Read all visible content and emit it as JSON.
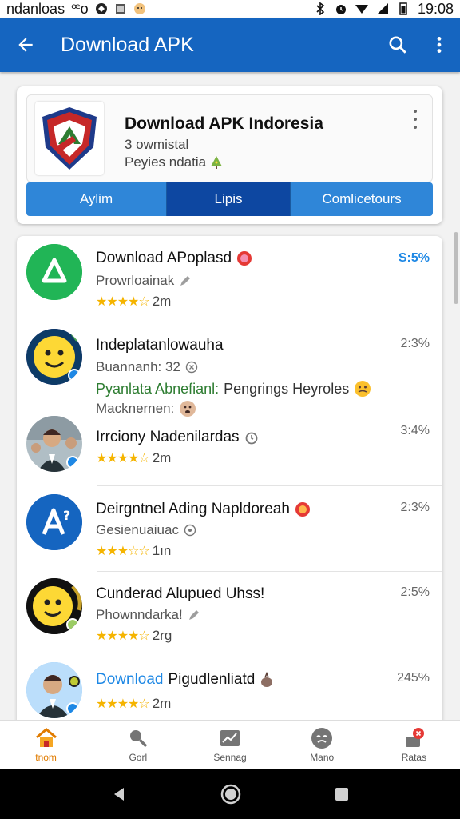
{
  "status_bar": {
    "left_text": "ndanloas",
    "icon_text": "ꟹo",
    "time": "19:08"
  },
  "app_bar": {
    "title": "Download APK"
  },
  "header": {
    "app_name": "Download APK Indoresia",
    "line1": "3 owmistal",
    "line2": "Peyies ndatia"
  },
  "tabs": [
    {
      "label": "Aylim"
    },
    {
      "label": "Lipis"
    },
    {
      "label": "Comlicetours"
    }
  ],
  "list": [
    {
      "title": "Download APoplasd",
      "sub": "Prowrloainak",
      "rating": "2m",
      "stars": "★★★★☆",
      "pct": "S:5%"
    },
    {
      "title": "Indeplatanlowauha",
      "sub": "Buannanh: 32",
      "green": "Pyanlata Abnefianl:",
      "green_rest": "Pengrings Heyroles",
      "sub2": "Macknernen:",
      "pct": "2:3%"
    },
    {
      "title": "Irrciony Nadenilardas",
      "rating": "2m",
      "stars": "★★★★☆",
      "pct": "3:4%"
    },
    {
      "title": "Deirgntnel Ading Napldoreah",
      "sub": "Gesienuaiuac",
      "rating": "1ın",
      "stars": "★★★☆☆",
      "pct": "2:3%"
    },
    {
      "title": "Cunderad Alupued Uhss!",
      "sub": "Phownndarka!",
      "rating": "2rg",
      "stars": "★★★★☆",
      "pct": "2:5%"
    },
    {
      "title_blue": "Download",
      "title_rest": "Pigudlenliatd",
      "rating": "2m",
      "stars": "★★★★☆",
      "pct": "245%"
    }
  ],
  "bottom_nav": [
    {
      "label": "tnom",
      "icon": "home-icon"
    },
    {
      "label": "Gorl",
      "icon": "search-icon"
    },
    {
      "label": "Sennag",
      "icon": "chart-icon"
    },
    {
      "label": "Mano",
      "icon": "face-icon"
    },
    {
      "label": "Ratas",
      "icon": "notifications-icon"
    }
  ],
  "colors": {
    "primary": "#1565c0",
    "tab": "#2f86d8",
    "tab_active": "#0d47a1",
    "accent": "#e07b00"
  }
}
